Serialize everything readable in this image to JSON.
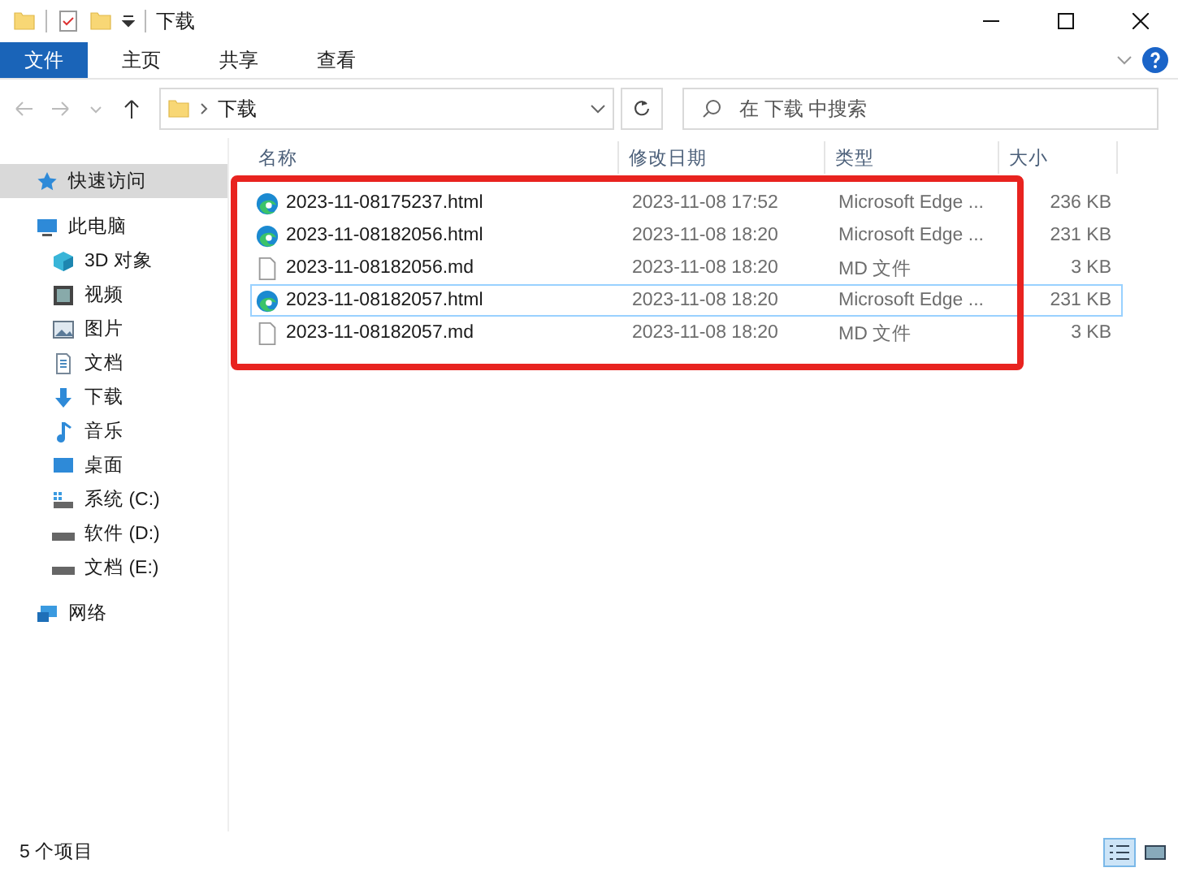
{
  "window": {
    "title": "下载"
  },
  "ribbon_tabs": [
    {
      "label": "文件",
      "selected": true
    },
    {
      "label": "主页",
      "selected": false
    },
    {
      "label": "共享",
      "selected": false
    },
    {
      "label": "查看",
      "selected": false
    }
  ],
  "address": {
    "path": "下载"
  },
  "search": {
    "placeholder": "在 下载 中搜索"
  },
  "sidebar": {
    "items": [
      {
        "label": "快速访问",
        "kind": "star",
        "selected": true
      },
      {
        "label": "此电脑",
        "kind": "pc",
        "selected": false,
        "children": [
          {
            "label": "3D 对象",
            "kind": "cube",
            "selected": false
          },
          {
            "label": "视频",
            "kind": "video",
            "selected": false
          },
          {
            "label": "图片",
            "kind": "picture",
            "selected": false
          },
          {
            "label": "文档",
            "kind": "doc",
            "selected": false
          },
          {
            "label": "下载",
            "kind": "download",
            "selected": false
          },
          {
            "label": "音乐",
            "kind": "music",
            "selected": false
          },
          {
            "label": "桌面",
            "kind": "desktop",
            "selected": false
          },
          {
            "label": "系统 (C:)",
            "kind": "sysdrive",
            "selected": false
          },
          {
            "label": "软件 (D:)",
            "kind": "drive",
            "selected": false
          },
          {
            "label": "文档 (E:)",
            "kind": "drive",
            "selected": false
          }
        ]
      },
      {
        "label": "网络",
        "kind": "network",
        "selected": false
      }
    ]
  },
  "table": {
    "columns": [
      "名称",
      "修改日期",
      "类型",
      "大小"
    ],
    "rows": [
      {
        "kind": "edge",
        "name": "2023-11-08175237.html",
        "date": "2023-11-08 17:52",
        "type": "Microsoft Edge ...",
        "size": "236 KB",
        "focused": false
      },
      {
        "kind": "edge",
        "name": "2023-11-08182056.html",
        "date": "2023-11-08 18:20",
        "type": "Microsoft Edge ...",
        "size": "231 KB",
        "focused": false
      },
      {
        "kind": "file",
        "name": "2023-11-08182056.md",
        "date": "2023-11-08 18:20",
        "type": "MD 文件",
        "size": "3 KB",
        "focused": false
      },
      {
        "kind": "edge",
        "name": "2023-11-08182057.html",
        "date": "2023-11-08 18:20",
        "type": "Microsoft Edge ...",
        "size": "231 KB",
        "focused": true
      },
      {
        "kind": "file",
        "name": "2023-11-08182057.md",
        "date": "2023-11-08 18:20",
        "type": "MD 文件",
        "size": "3 KB",
        "focused": false
      }
    ]
  },
  "highlight": true,
  "status_bar": {
    "count": "5 个项目",
    "view_buttons": [
      {
        "kind": "details",
        "selected": true
      },
      {
        "kind": "tiles",
        "selected": false
      }
    ]
  }
}
